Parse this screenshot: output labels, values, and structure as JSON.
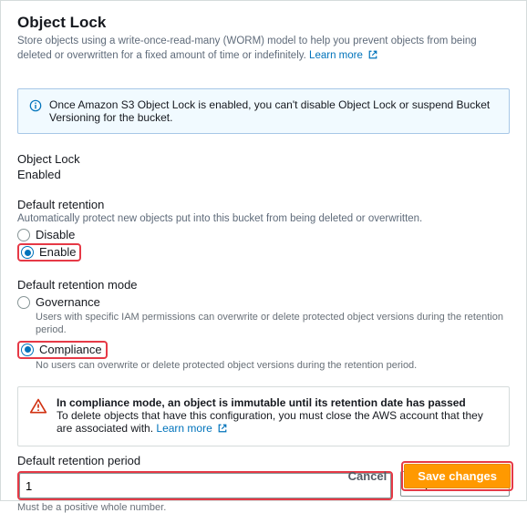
{
  "panel": {
    "title": "Object Lock",
    "description": "Store objects using a write-once-read-many (WORM) model to help you prevent objects from being deleted or overwritten for a fixed amount of time or indefinitely.",
    "learn_more": "Learn more"
  },
  "info_banner": {
    "text": "Once Amazon S3 Object Lock is enabled, you can't disable Object Lock or suspend Bucket Versioning for the bucket."
  },
  "object_lock": {
    "label": "Object Lock",
    "value": "Enabled"
  },
  "default_retention": {
    "label": "Default retention",
    "help": "Automatically protect new objects put into this bucket from being deleted or overwritten.",
    "options": {
      "disable": "Disable",
      "enable": "Enable"
    },
    "selected": "enable"
  },
  "retention_mode": {
    "label": "Default retention mode",
    "options": {
      "governance": {
        "label": "Governance",
        "help": "Users with specific IAM permissions can overwrite or delete protected object versions during the retention period."
      },
      "compliance": {
        "label": "Compliance",
        "help": "No users can overwrite or delete protected object versions during the retention period."
      }
    },
    "selected": "compliance"
  },
  "compliance_warning": {
    "title": "In compliance mode, an object is immutable until its retention date has passed",
    "body": "To delete objects that have this configuration, you must close the AWS account that they are associated with.",
    "learn_more": "Learn more"
  },
  "retention_period": {
    "label": "Default retention period",
    "value": "1",
    "unit": "Days",
    "hint": "Must be a positive whole number."
  },
  "footer": {
    "cancel": "Cancel",
    "save": "Save changes"
  }
}
